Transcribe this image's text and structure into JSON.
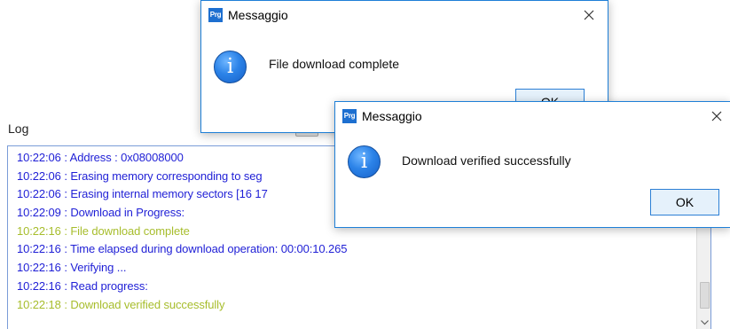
{
  "log": {
    "title": "Log",
    "lines": [
      {
        "text": "10:22:06 :   Address        : 0x08008000",
        "level": "info"
      },
      {
        "text": "10:22:06 : Erasing memory corresponding to seg",
        "level": "info"
      },
      {
        "text": "10:22:06 : Erasing internal memory sectors [16 17",
        "level": "info"
      },
      {
        "text": "10:22:09 : Download in Progress:",
        "level": "info"
      },
      {
        "text": "10:22:16 : File download complete",
        "level": "success"
      },
      {
        "text": "10:22:16 : Time elapsed during download operation: 00:00:10.265",
        "level": "info"
      },
      {
        "text": "10:22:16 : Verifying ...",
        "level": "info"
      },
      {
        "text": "10:22:16 : Read progress:",
        "level": "info"
      },
      {
        "text": "10:22:18 : Download verified successfully",
        "level": "success"
      }
    ]
  },
  "dialogs": [
    {
      "app_icon": "Prg",
      "title": "Messaggio",
      "message": "File download complete",
      "ok_label": "OK",
      "icon": "info-icon"
    },
    {
      "app_icon": "Prg",
      "title": "Messaggio",
      "message": "Download verified successfully",
      "ok_label": "OK",
      "icon": "info-icon"
    }
  ],
  "colors": {
    "info_text": "#1f1fd6",
    "success_text": "#a7bd2c",
    "dialog_border": "#1e7fd7",
    "ok_button_bg": "#e5f1fb"
  }
}
